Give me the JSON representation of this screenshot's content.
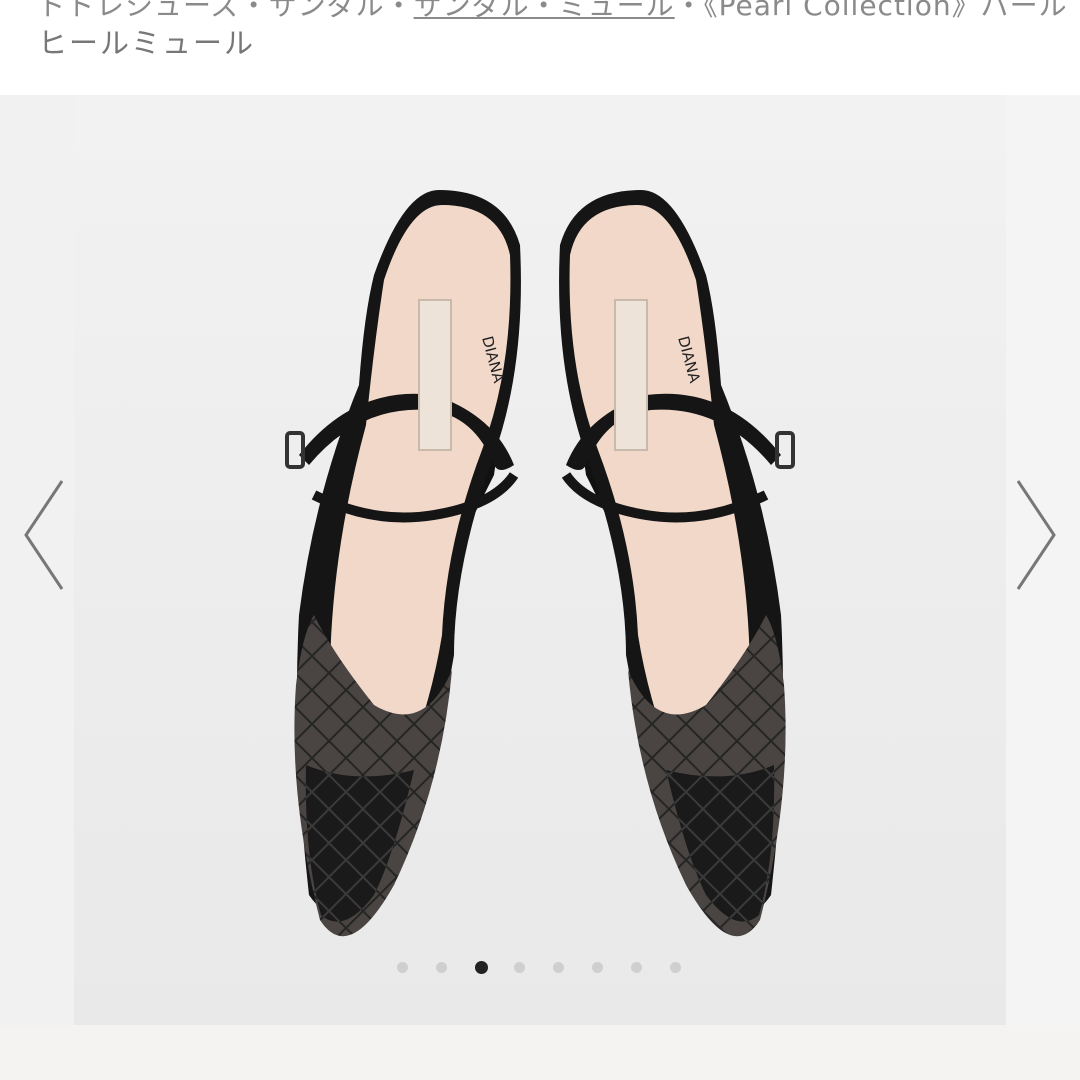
{
  "breadcrumb": {
    "prefix": "ドドレシューズ・サンダル・",
    "link": "サンダル・ミュール",
    "suffix": "・《Pearl Collection》パール"
  },
  "product": {
    "title": "ヒールミュール"
  },
  "gallery": {
    "brand_label": "DIANA",
    "prev_icon": "chevron-left-icon",
    "next_icon": "chevron-right-icon",
    "dot_count": 8,
    "active_index": 2
  },
  "colors": {
    "shoe": "#141414",
    "insole": "#f0d5c7",
    "background": "#eeeeee"
  }
}
